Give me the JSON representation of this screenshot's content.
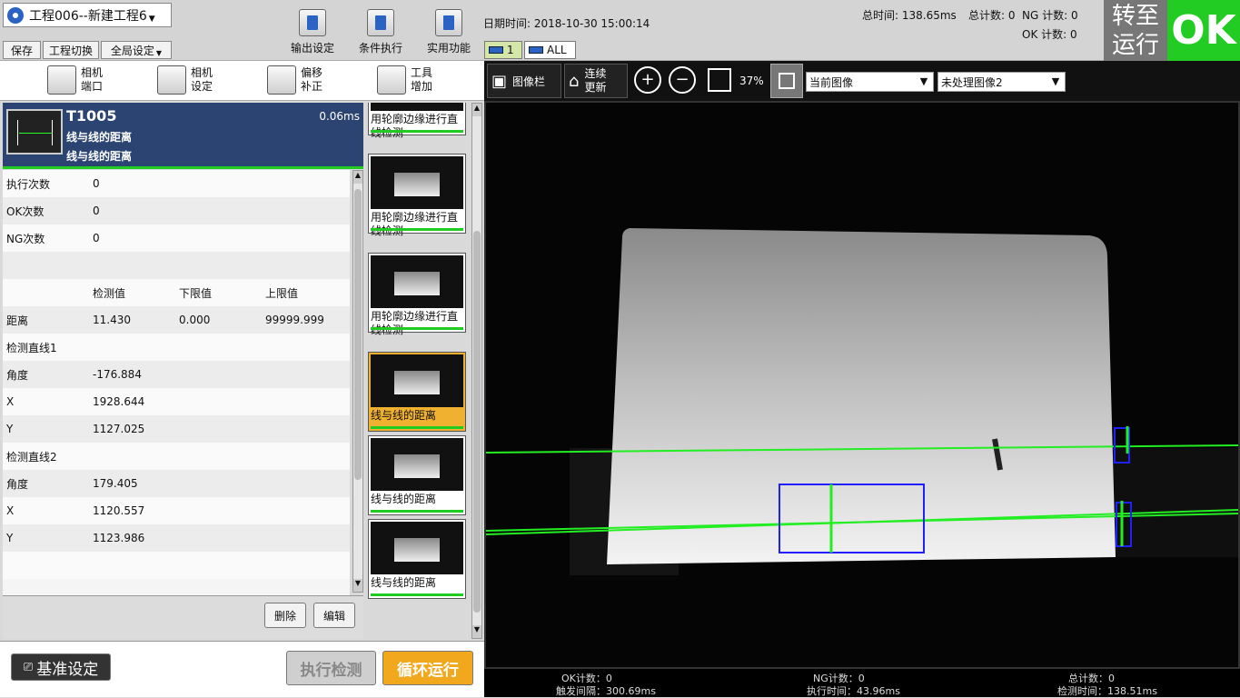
{
  "app": {
    "project_name": "工程006--新建工程6",
    "menu": [
      "保存",
      "工程切换",
      "全局设定"
    ],
    "toolbar_buttons": [
      "输出设定",
      "条件执行",
      "实用功能"
    ],
    "datetime": "日期时间: 2018-10-30 15:00:14",
    "camera_tabs": [
      "1",
      "ALL"
    ],
    "stats": {
      "total_time": "总时间: 138.65ms",
      "total_count": "总计数: 0",
      "ng_count": "NG 计数: 0",
      "ok_count": "OK 计数: 0"
    },
    "run_button": "转至\n运行",
    "result": "OK"
  },
  "left_toolbar": [
    {
      "label": "相机\n端口"
    },
    {
      "label": "相机\n设定"
    },
    {
      "label": "偏移\n补正"
    },
    {
      "label": "工具\n增加"
    }
  ],
  "tool_header": {
    "id": "T1005",
    "time": "0.06ms",
    "name1": "线与线的距离",
    "name2": "线与线的距离"
  },
  "table_rows": [
    {
      "c1": "执行次数",
      "c2": "0",
      "c3": "",
      "c4": ""
    },
    {
      "c1": "OK次数",
      "c2": "0",
      "c3": "",
      "c4": ""
    },
    {
      "c1": "NG次数",
      "c2": "0",
      "c3": "",
      "c4": ""
    },
    {
      "c1": "",
      "c2": "",
      "c3": "",
      "c4": ""
    },
    {
      "c1": "",
      "c2": "检测值",
      "c3": "下限值",
      "c4": "上限值"
    },
    {
      "c1": "距离",
      "c2": "11.430",
      "c3": "0.000",
      "c4": "99999.999"
    },
    {
      "c1": "检测直线1",
      "c2": "",
      "c3": "",
      "c4": ""
    },
    {
      "c1": "角度",
      "c2": "-176.884",
      "c3": "",
      "c4": ""
    },
    {
      "c1": "X",
      "c2": "1928.644",
      "c3": "",
      "c4": ""
    },
    {
      "c1": "Y",
      "c2": "1127.025",
      "c3": "",
      "c4": ""
    },
    {
      "c1": "检测直线2",
      "c2": "",
      "c3": "",
      "c4": ""
    },
    {
      "c1": "角度",
      "c2": "179.405",
      "c3": "",
      "c4": ""
    },
    {
      "c1": "X",
      "c2": "1120.557",
      "c3": "",
      "c4": ""
    },
    {
      "c1": "Y",
      "c2": "1123.986",
      "c3": "",
      "c4": ""
    },
    {
      "c1": "",
      "c2": "",
      "c3": "",
      "c4": ""
    }
  ],
  "thumbnails": [
    {
      "label": "用轮廓边缘进行直线检测",
      "selected": false
    },
    {
      "label": "用轮廓边缘进行直线检测",
      "selected": false
    },
    {
      "label": "用轮廓边缘进行直线检测",
      "selected": false
    },
    {
      "label": "线与线的距离",
      "selected": true
    },
    {
      "label": "线与线的距离",
      "selected": false
    },
    {
      "label": "线与线的距离",
      "selected": false
    }
  ],
  "actions": {
    "delete": "删除",
    "edit": "编辑"
  },
  "bottom": {
    "baseline": "基准设定",
    "exec": "执行检测",
    "loop": "循环运行"
  },
  "image_toolbar": {
    "image_bar": "图像栏",
    "continuous": "连续\n更新",
    "zoom": "37%",
    "select1": "当前图像",
    "select2": "未处理图像2"
  },
  "status_bar": {
    "ok_count": "OK计数：0",
    "trigger": "触发间隔：300.69ms",
    "ng_count": "NG计数：0",
    "exec_time": "执行时间：43.96ms",
    "total": "总计数：0",
    "detect_time": "检测时间：138.51ms"
  },
  "colors": {
    "ok_green": "#22cc22",
    "header_blue": "#2b4472",
    "highlight": "#f0b030",
    "accent_orange": "#f2a81d"
  }
}
